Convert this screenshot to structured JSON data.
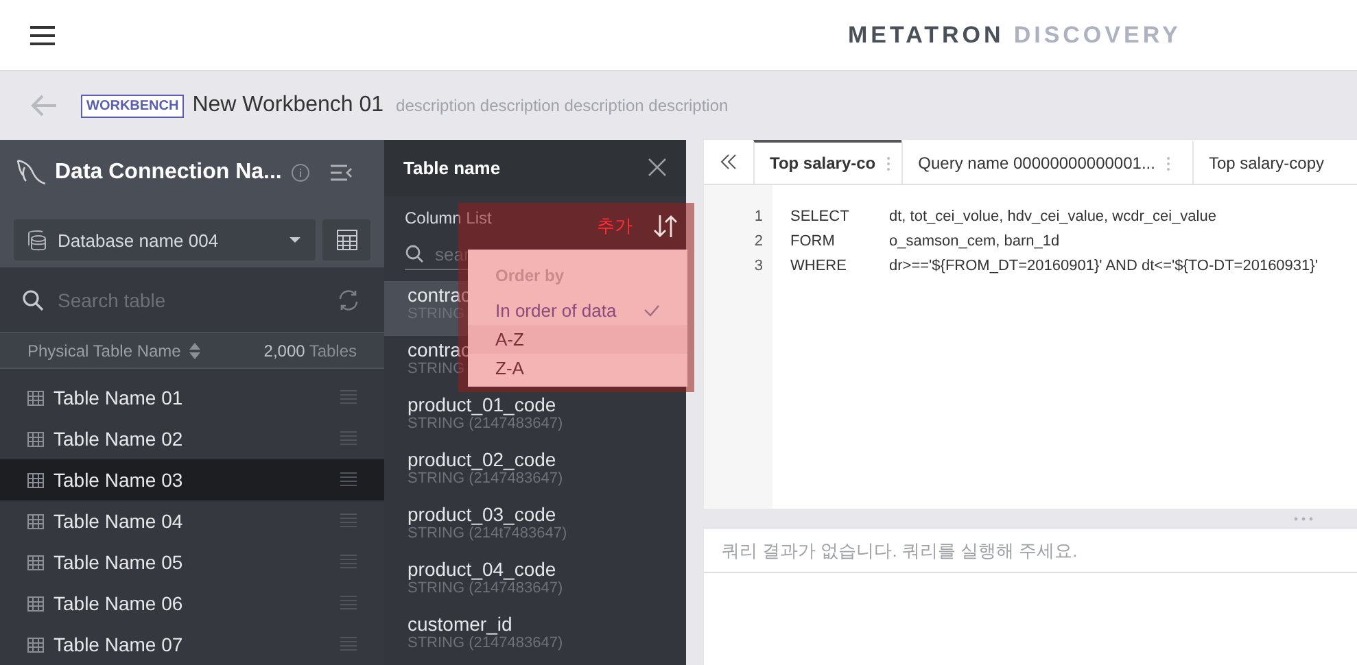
{
  "header": {
    "logo_primary": "METATRON",
    "logo_secondary": "DISCOVERY"
  },
  "workbench": {
    "badge": "WORKBENCH",
    "title": "New Workbench 01",
    "description": "description description description description"
  },
  "connection": {
    "name": "Data Connection Na...",
    "database": "Database name 004",
    "search_placeholder": "Search table",
    "list_header": {
      "label": "Physical Table Name",
      "count": "2,000",
      "unit": "Tables"
    },
    "tables": [
      {
        "name": "Table Name 01",
        "selected": false
      },
      {
        "name": "Table Name 02",
        "selected": false
      },
      {
        "name": "Table Name 03",
        "selected": true
      },
      {
        "name": "Table Name 04",
        "selected": false
      },
      {
        "name": "Table Name 05",
        "selected": false
      },
      {
        "name": "Table Name 06",
        "selected": false
      },
      {
        "name": "Table Name 07",
        "selected": false
      }
    ]
  },
  "column_panel": {
    "title": "Table name",
    "section_label": "Column List",
    "search_placeholder": "sear",
    "columns": [
      {
        "name": "contrac",
        "type": "STRING",
        "selected": true
      },
      {
        "name": "contrac",
        "type": "STRING",
        "selected": false
      },
      {
        "name": "product_01_code",
        "type": "STRING (2147483647)",
        "selected": false
      },
      {
        "name": "product_02_code",
        "type": "STRING (2147483647)",
        "selected": false
      },
      {
        "name": "product_03_code",
        "type": "STRING (214t7483647)",
        "selected": false
      },
      {
        "name": "product_04_code",
        "type": "STRING (2147483647)",
        "selected": false
      },
      {
        "name": "customer_id",
        "type": "STRING (2147483647)",
        "selected": false
      }
    ],
    "annotation": "추가",
    "sort_menu": {
      "heading": "Order by",
      "options": [
        {
          "label": "In order of data",
          "selected": true
        },
        {
          "label": "A-Z",
          "selected": false
        },
        {
          "label": "Z-A",
          "selected": false
        }
      ]
    }
  },
  "editor": {
    "tabs": [
      {
        "label": "Top salary-co",
        "selected": true
      },
      {
        "label": "Query name 00000000000001...",
        "selected": false
      },
      {
        "label": "Top salary-copy",
        "selected": false
      }
    ],
    "lines": [
      {
        "number": "1",
        "keyword": "SELECT",
        "text": "dt, tot_cei_volue, hdv_cei_value, wcdr_cei_value"
      },
      {
        "number": "2",
        "keyword": "FORM",
        "text": "o_samson_cem, barn_1d"
      },
      {
        "number": "3",
        "keyword": "WHERE",
        "text": "dr>=='${FROM_DT=20160901}' AND dt<='${TO-DT=20160931}'"
      }
    ]
  },
  "results": {
    "message": "쿼리 결과가 없습니다. 쿼리를 실행해 주세요."
  }
}
